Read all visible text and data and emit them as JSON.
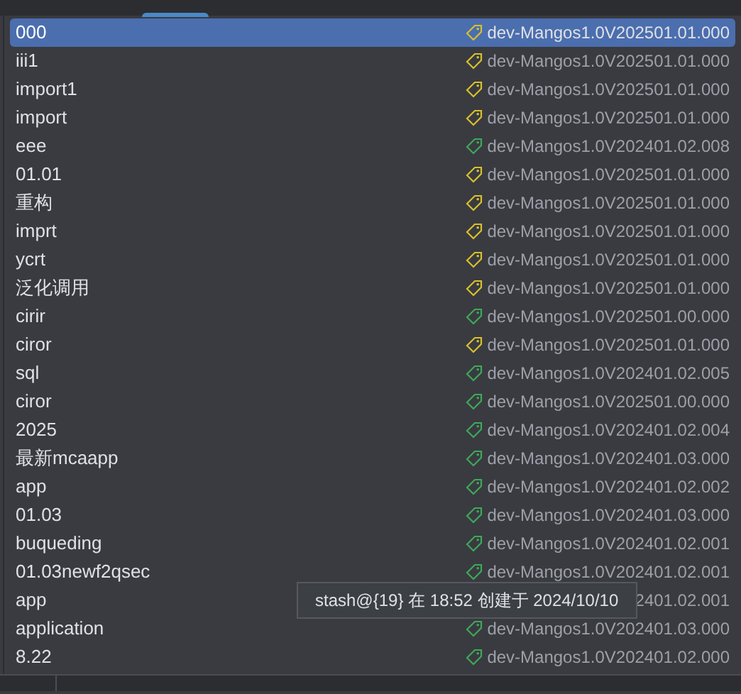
{
  "stashes": [
    {
      "name": "000",
      "tag": "dev-Mangos1.0V202501.01.000",
      "color": "#d9c02c",
      "selected": true
    },
    {
      "name": "iii1",
      "tag": "dev-Mangos1.0V202501.01.000",
      "color": "#d9c02c",
      "selected": false
    },
    {
      "name": "import1",
      "tag": "dev-Mangos1.0V202501.01.000",
      "color": "#d9c02c",
      "selected": false
    },
    {
      "name": "import",
      "tag": "dev-Mangos1.0V202501.01.000",
      "color": "#d9c02c",
      "selected": false
    },
    {
      "name": "eee",
      "tag": "dev-Mangos1.0V202401.02.008",
      "color": "#3fa85a",
      "selected": false
    },
    {
      "name": "01.01",
      "tag": "dev-Mangos1.0V202501.01.000",
      "color": "#d9c02c",
      "selected": false
    },
    {
      "name": "重构",
      "tag": "dev-Mangos1.0V202501.01.000",
      "color": "#d9c02c",
      "selected": false
    },
    {
      "name": "imprt",
      "tag": "dev-Mangos1.0V202501.01.000",
      "color": "#d9c02c",
      "selected": false
    },
    {
      "name": "ycrt",
      "tag": "dev-Mangos1.0V202501.01.000",
      "color": "#d9c02c",
      "selected": false
    },
    {
      "name": "泛化调用",
      "tag": "dev-Mangos1.0V202501.01.000",
      "color": "#d9c02c",
      "selected": false
    },
    {
      "name": "cirir",
      "tag": "dev-Mangos1.0V202501.00.000",
      "color": "#3fa85a",
      "selected": false
    },
    {
      "name": "ciror",
      "tag": "dev-Mangos1.0V202501.01.000",
      "color": "#d9c02c",
      "selected": false
    },
    {
      "name": "sql",
      "tag": "dev-Mangos1.0V202401.02.005",
      "color": "#3fa85a",
      "selected": false
    },
    {
      "name": "ciror",
      "tag": "dev-Mangos1.0V202501.00.000",
      "color": "#3fa85a",
      "selected": false
    },
    {
      "name": "2025",
      "tag": "dev-Mangos1.0V202401.02.004",
      "color": "#3fa85a",
      "selected": false
    },
    {
      "name": "最新mcaapp",
      "tag": "dev-Mangos1.0V202401.03.000",
      "color": "#3fa85a",
      "selected": false
    },
    {
      "name": "app",
      "tag": "dev-Mangos1.0V202401.02.002",
      "color": "#3fa85a",
      "selected": false
    },
    {
      "name": "01.03",
      "tag": "dev-Mangos1.0V202401.03.000",
      "color": "#3fa85a",
      "selected": false
    },
    {
      "name": "buqueding",
      "tag": "dev-Mangos1.0V202401.02.001",
      "color": "#3fa85a",
      "selected": false
    },
    {
      "name": "01.03newf2qsec",
      "tag": "dev-Mangos1.0V202401.02.001",
      "color": "#3fa85a",
      "selected": false
    },
    {
      "name": "app",
      "tag": "2401.02.001",
      "selected": false
    },
    {
      "name": "application",
      "tag": "dev-Mangos1.0V202401.03.000",
      "color": "#3fa85a",
      "selected": false
    },
    {
      "name": "8.22",
      "tag": "dev-Mangos1.0V202401.02.000",
      "color": "#3fa85a",
      "selected": false
    }
  ],
  "tooltip": {
    "text": "stash@{19} 在 18:52 创建于 2024/10/10"
  }
}
